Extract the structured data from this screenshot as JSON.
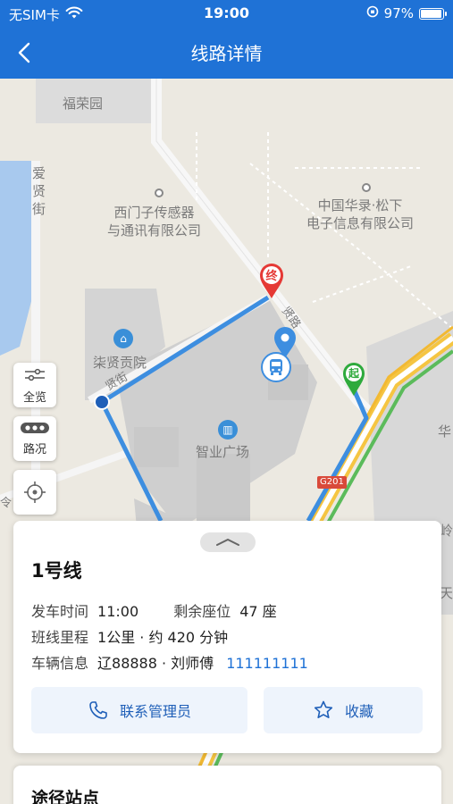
{
  "status_bar": {
    "carrier": "无SIM卡",
    "time": "19:00",
    "battery": "97%",
    "battery_level": 0.97
  },
  "nav": {
    "title": "线路详情",
    "back_icon": "chevron-left-icon"
  },
  "map": {
    "labels": {
      "furongyuan": "福荣园",
      "aixianjie": "爱\n贤\n街",
      "ximenzi": "西门子传感器\n与通讯有限公司",
      "panasonic": "中国华录·松下\n电子信息有限公司",
      "qixiangongyuan": "柒贤贡院",
      "zhiyeguangchang": "智业广场",
      "xianlu": "贤路",
      "xianjie": "贤街",
      "g201": "G201",
      "hua": "华",
      "tian": "天",
      "ling": "岭",
      "lingshu": "令"
    },
    "markers": {
      "end": "终",
      "start": "起"
    },
    "tools": [
      {
        "label": "全览",
        "icon": "overview-icon"
      },
      {
        "label": "路况",
        "icon": "traffic-icon"
      },
      {
        "label": "",
        "icon": "locate-icon"
      }
    ],
    "colors": {
      "route": "#3d8ee0",
      "end_marker": "#e53935",
      "start_marker": "#2eaa3c",
      "highway": "#f5c542"
    }
  },
  "route_card": {
    "line_name": "1号线",
    "departure_label": "发车时间",
    "departure_time": "11:00",
    "seats_label": "剩余座位",
    "seats_value": "47 座",
    "distance_label": "班线里程",
    "distance_value": "1公里 · 约 420 分钟",
    "vehicle_label": "车辆信息",
    "vehicle_value": "辽88888 · 刘师傅",
    "phone": "111111111",
    "contact_button": "联系管理员",
    "favorite_button": "收藏"
  },
  "stops_card": {
    "title": "途径站点"
  }
}
